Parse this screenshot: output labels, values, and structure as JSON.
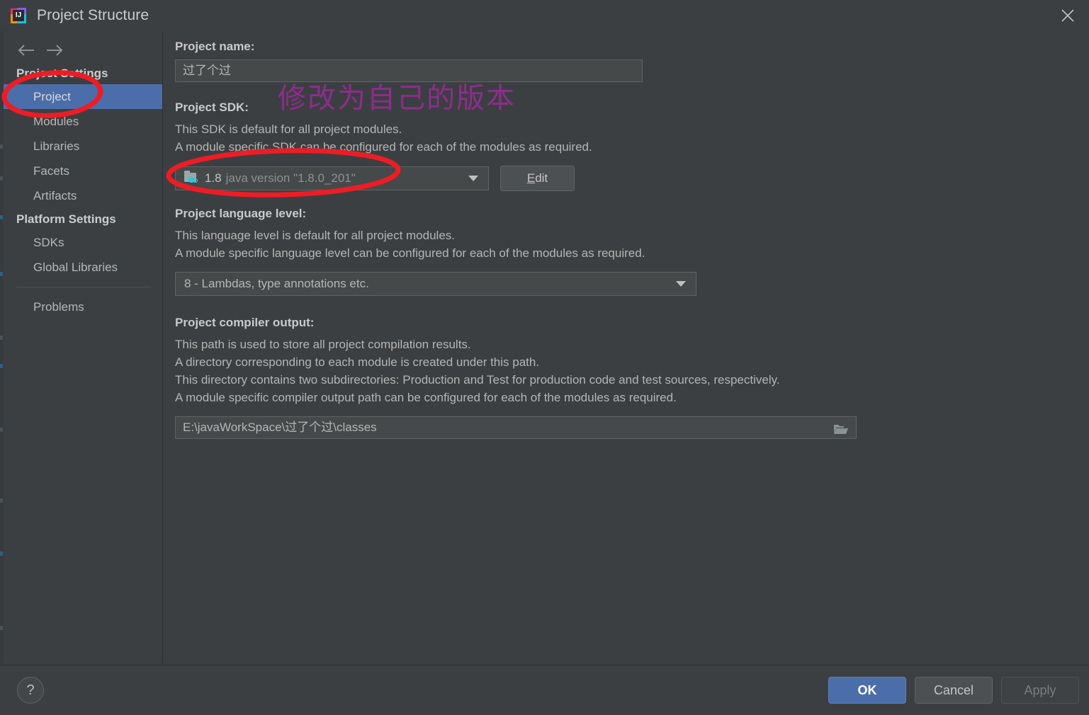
{
  "window": {
    "title": "Project Structure",
    "app_icon": "intellij-idea-icon",
    "close_label": "✕"
  },
  "sidebar": {
    "back_icon": "arrow-left-icon",
    "forward_icon": "arrow-right-icon",
    "groups": [
      {
        "header": "Project Settings",
        "items": [
          {
            "label": "Project",
            "selected": true
          },
          {
            "label": "Modules",
            "selected": false
          },
          {
            "label": "Libraries",
            "selected": false
          },
          {
            "label": "Facets",
            "selected": false
          },
          {
            "label": "Artifacts",
            "selected": false
          }
        ]
      },
      {
        "header": "Platform Settings",
        "items": [
          {
            "label": "SDKs",
            "selected": false
          },
          {
            "label": "Global Libraries",
            "selected": false
          }
        ]
      }
    ],
    "problems": "Problems"
  },
  "main": {
    "project_name": {
      "label": "Project name:",
      "value": "过了个过"
    },
    "project_sdk": {
      "label": "Project SDK:",
      "desc_line1": "This SDK is default for all project modules.",
      "desc_line2": "A module specific SDK can be configured for each of the modules as required.",
      "sdk_version": "1.8",
      "sdk_description": "java version \"1.8.0_201\"",
      "sdk_icon": "java-folder-icon",
      "edit_button": "Edit",
      "edit_mnemonic": "E",
      "edit_rest": "dit"
    },
    "language_level": {
      "label": "Project language level:",
      "desc_line1": "This language level is default for all project modules.",
      "desc_line2": "A module specific language level can be configured for each of the modules as required.",
      "value": "8 - Lambdas, type annotations etc."
    },
    "compiler_output": {
      "label": "Project compiler output:",
      "desc_line1": "This path is used to store all project compilation results.",
      "desc_line2": "A directory corresponding to each module is created under this path.",
      "desc_line3": "This directory contains two subdirectories: Production and Test for production code and test sources, respectively.",
      "desc_line4": "A module specific compiler output path can be configured for each of the modules as required.",
      "value": "E:\\javaWorkSpace\\过了个过\\classes",
      "browse_icon": "folder-open-icon"
    }
  },
  "footer": {
    "help_label": "?",
    "ok_label": "OK",
    "cancel_label": "Cancel",
    "apply_label": "Apply",
    "apply_disabled": true
  },
  "annotations": {
    "chinese_note": "修改为自己的版本",
    "note_color": "#8E2C8E",
    "ellipse_color": "#EE1C25",
    "ellipses": [
      {
        "name": "ellipse-around-project-item"
      },
      {
        "name": "ellipse-around-sdk-combo"
      }
    ]
  },
  "colors": {
    "background": "#3C3F41",
    "selection": "#4B6EAB",
    "field_background": "#45494A",
    "field_border": "#5E6364",
    "text": "#B6B6B6",
    "label_text": "#C9C9C9",
    "muted_text": "#8E9194",
    "java_cyan": "#39C2D7"
  }
}
